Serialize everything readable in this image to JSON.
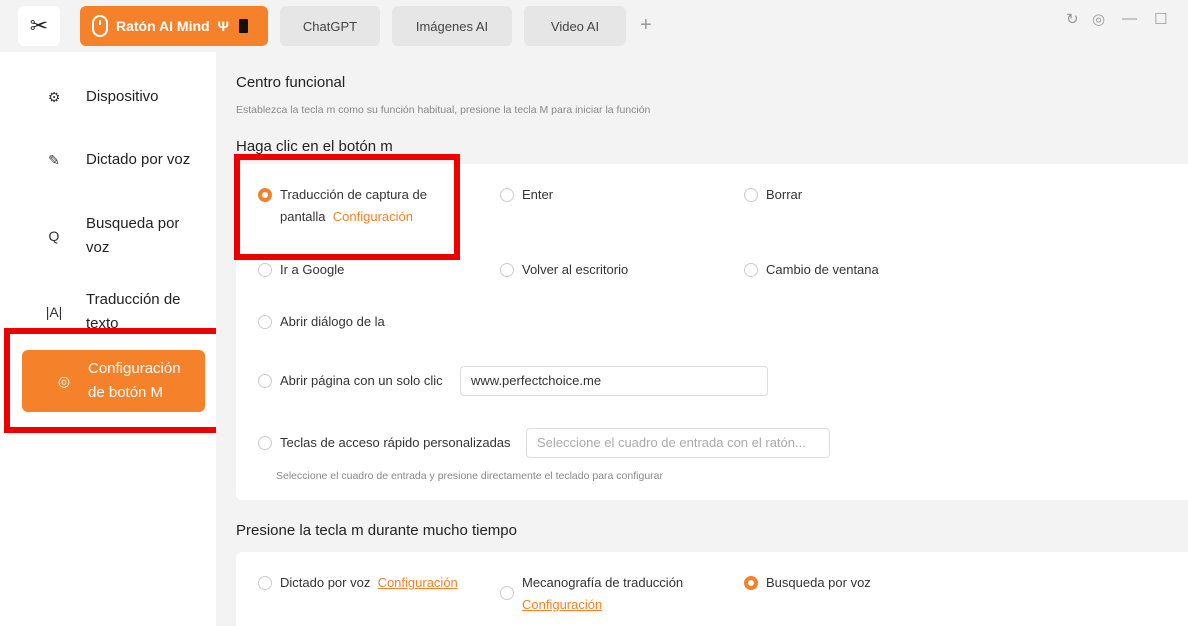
{
  "topbar": {
    "logo_glyph": "✂",
    "active_tab": {
      "label": "Ratón AI Mind",
      "status_glyph": "Ψ"
    },
    "tabs": [
      {
        "label": "ChatGPT"
      },
      {
        "label": "Imágenes AI"
      },
      {
        "label": "Video AI"
      }
    ],
    "add_tab": "+",
    "window_controls": {
      "refresh": "↻",
      "settings": "◎",
      "minimize": "—",
      "maximize": "☐"
    }
  },
  "sidebar": {
    "items": [
      {
        "label": "Dispositivo",
        "icon": "⚙"
      },
      {
        "label": "Dictado por voz",
        "icon": "✎"
      },
      {
        "label": "Busqueda por voz",
        "icon": "Q"
      },
      {
        "label": "Traducción de texto",
        "icon": "|A|"
      },
      {
        "label": "Configuración de botón M",
        "icon": "◎"
      }
    ]
  },
  "main": {
    "title": "Centro funcional",
    "subtitle": "Establezca la tecla m como su función habitual, presione la tecla M para iniciar la función",
    "click_section": {
      "title": "Haga clic en el botón m",
      "options": [
        {
          "label": "Traducción de captura de pantalla",
          "link": "Configuración",
          "selected": true
        },
        {
          "label": "Enter",
          "selected": false
        },
        {
          "label": "Borrar",
          "selected": false
        },
        {
          "label": "Ir a Google",
          "selected": false
        },
        {
          "label": "Volver al escritorio",
          "selected": false
        },
        {
          "label": "Cambio de ventana",
          "selected": false
        },
        {
          "label": "Abrir diálogo de la",
          "selected": false
        },
        {
          "label": "Abrir página con un solo clic",
          "value": "www.perfectchoice.me",
          "selected": false
        },
        {
          "label": "Teclas de acceso rápido personalizadas",
          "placeholder": "Seleccione el cuadro de entrada con el ratón...",
          "selected": false
        }
      ],
      "hint": "Seleccione el cuadro de entrada y presione directamente el teclado para configurar"
    },
    "long_press_section": {
      "title": "Presione la tecla m durante mucho tiempo",
      "options": [
        {
          "label": "Dictado por voz",
          "link": "Configuración",
          "selected": false
        },
        {
          "label": "Mecanografía de traducción",
          "link": "Configuración",
          "selected": false
        },
        {
          "label": "Busqueda por voz",
          "selected": true
        }
      ]
    }
  },
  "colors": {
    "accent": "#f5822a",
    "highlight": "#ee0000"
  }
}
